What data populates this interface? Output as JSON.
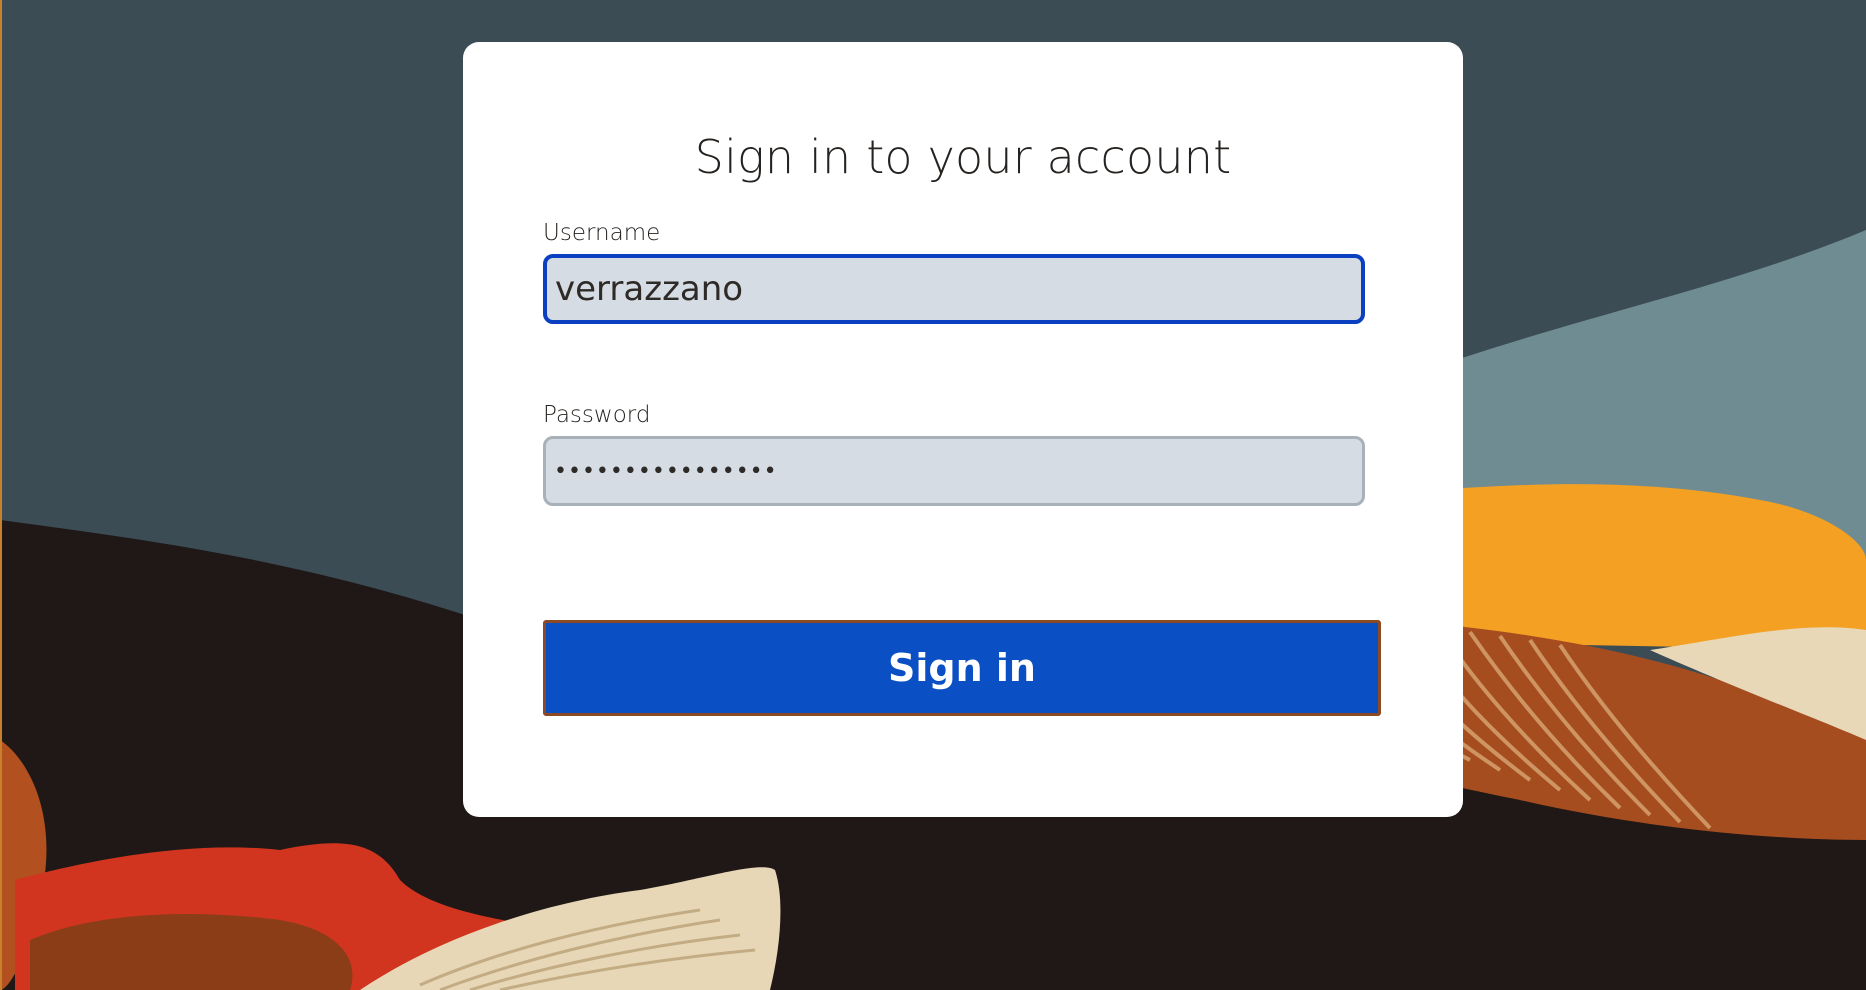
{
  "page": {
    "title": "Sign in to your account"
  },
  "form": {
    "username_label": "Username",
    "username_value": "verrazzano",
    "password_label": "Password",
    "password_value": "••••••••••••••••",
    "submit_label": "Sign in"
  },
  "colors": {
    "primary_button": "#0a4fc4",
    "focus_border": "#0a3fbf",
    "field_background": "#d6dce3",
    "card_background": "#ffffff"
  },
  "background": {
    "style": "abstract-landscape-illustration"
  }
}
